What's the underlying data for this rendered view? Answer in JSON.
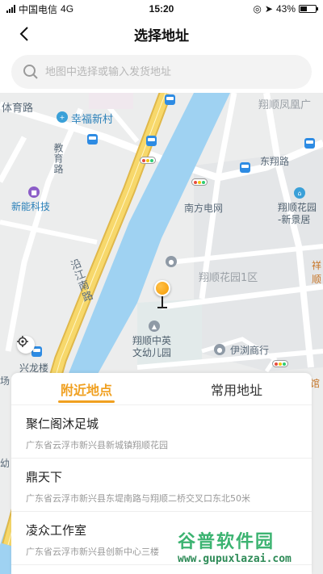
{
  "status_bar": {
    "carrier": "中国电信",
    "network": "4G",
    "time": "15:20",
    "battery_percent": "43%",
    "battery_level": 0.43
  },
  "nav": {
    "title": "选择地址",
    "back_icon": "chevron-left-icon"
  },
  "search": {
    "placeholder": "地图中选择或输入发货地址",
    "value": "",
    "icon": "search-icon"
  },
  "map": {
    "labels": {
      "tiyu_road": "体育路",
      "xingfu_village": "幸福新村",
      "jiaoyu_road": "教育路",
      "xinneng_tech": "新能科技",
      "yanjiang_road": "沿江南路",
      "nanfang_grid": "南方电网",
      "xiangshun_garden_1": "翔顺花园1区",
      "xiangshun_kindergarten_1": "翔顺中英",
      "xiangshun_kindergarten_2": "文幼儿园",
      "yiliu_business": "伊浏商行",
      "xiangshun_fenghuang": "翔顺凤凰广",
      "dongxiang_road": "东翔路",
      "xiangshun_garden_new_1": "翔顺花园",
      "xiangshun_garden_new_2": "-新景居",
      "xinglong_building": "兴龙楼",
      "left_edge_1": "场",
      "left_edge_2": "幼",
      "right_edge_1": "祥",
      "right_edge_2": "顺",
      "right_edge_3": "食馆"
    },
    "colors": {
      "river": "#9fd2f2",
      "highway": "#f7d86b",
      "road": "#ffffff",
      "land": "#eceded",
      "pin": "#f59a00"
    }
  },
  "tabs": [
    {
      "label": "附近地点",
      "active": true
    },
    {
      "label": "常用地址",
      "active": false
    }
  ],
  "places": [
    {
      "name": "聚仁阁沐足城",
      "address": "广东省云浮市新兴县新城镇翔顺花园"
    },
    {
      "name": "鼎天下",
      "address": "广东省云浮市新兴县东堤南路与翔顺二桥交叉口东北50米"
    },
    {
      "name": "凌众工作室",
      "address": "广东省云浮市新兴县创新中心三楼"
    }
  ],
  "watermark": {
    "title": "谷普软件园",
    "url": "www.gupuxlazai.com"
  }
}
